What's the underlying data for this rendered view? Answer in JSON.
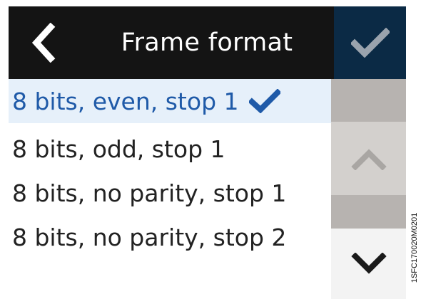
{
  "header": {
    "title": "Frame format",
    "back_icon": "chevron-left-icon",
    "confirm_icon": "check-icon"
  },
  "options": [
    {
      "label": "8 bits, even, stop 1",
      "selected": true
    },
    {
      "label": "8 bits, odd, stop 1",
      "selected": false
    },
    {
      "label": "8 bits, no parity, stop 1",
      "selected": false
    },
    {
      "label": "8 bits, no parity, stop 2",
      "selected": false
    }
  ],
  "scroll": {
    "up_icon": "chevron-up-icon",
    "down_icon": "chevron-down-icon"
  },
  "figure_code": "1SFC170020M0201",
  "colors": {
    "header_bg": "#141414",
    "confirm_bg": "#0b2a45",
    "selected_bg": "#e6f0fa",
    "selected_text": "#1f5aa8",
    "scroll_dark": "#b7b3b0",
    "scroll_up_bg": "#d3d0cd",
    "scroll_down_bg": "#f3f3f3"
  }
}
